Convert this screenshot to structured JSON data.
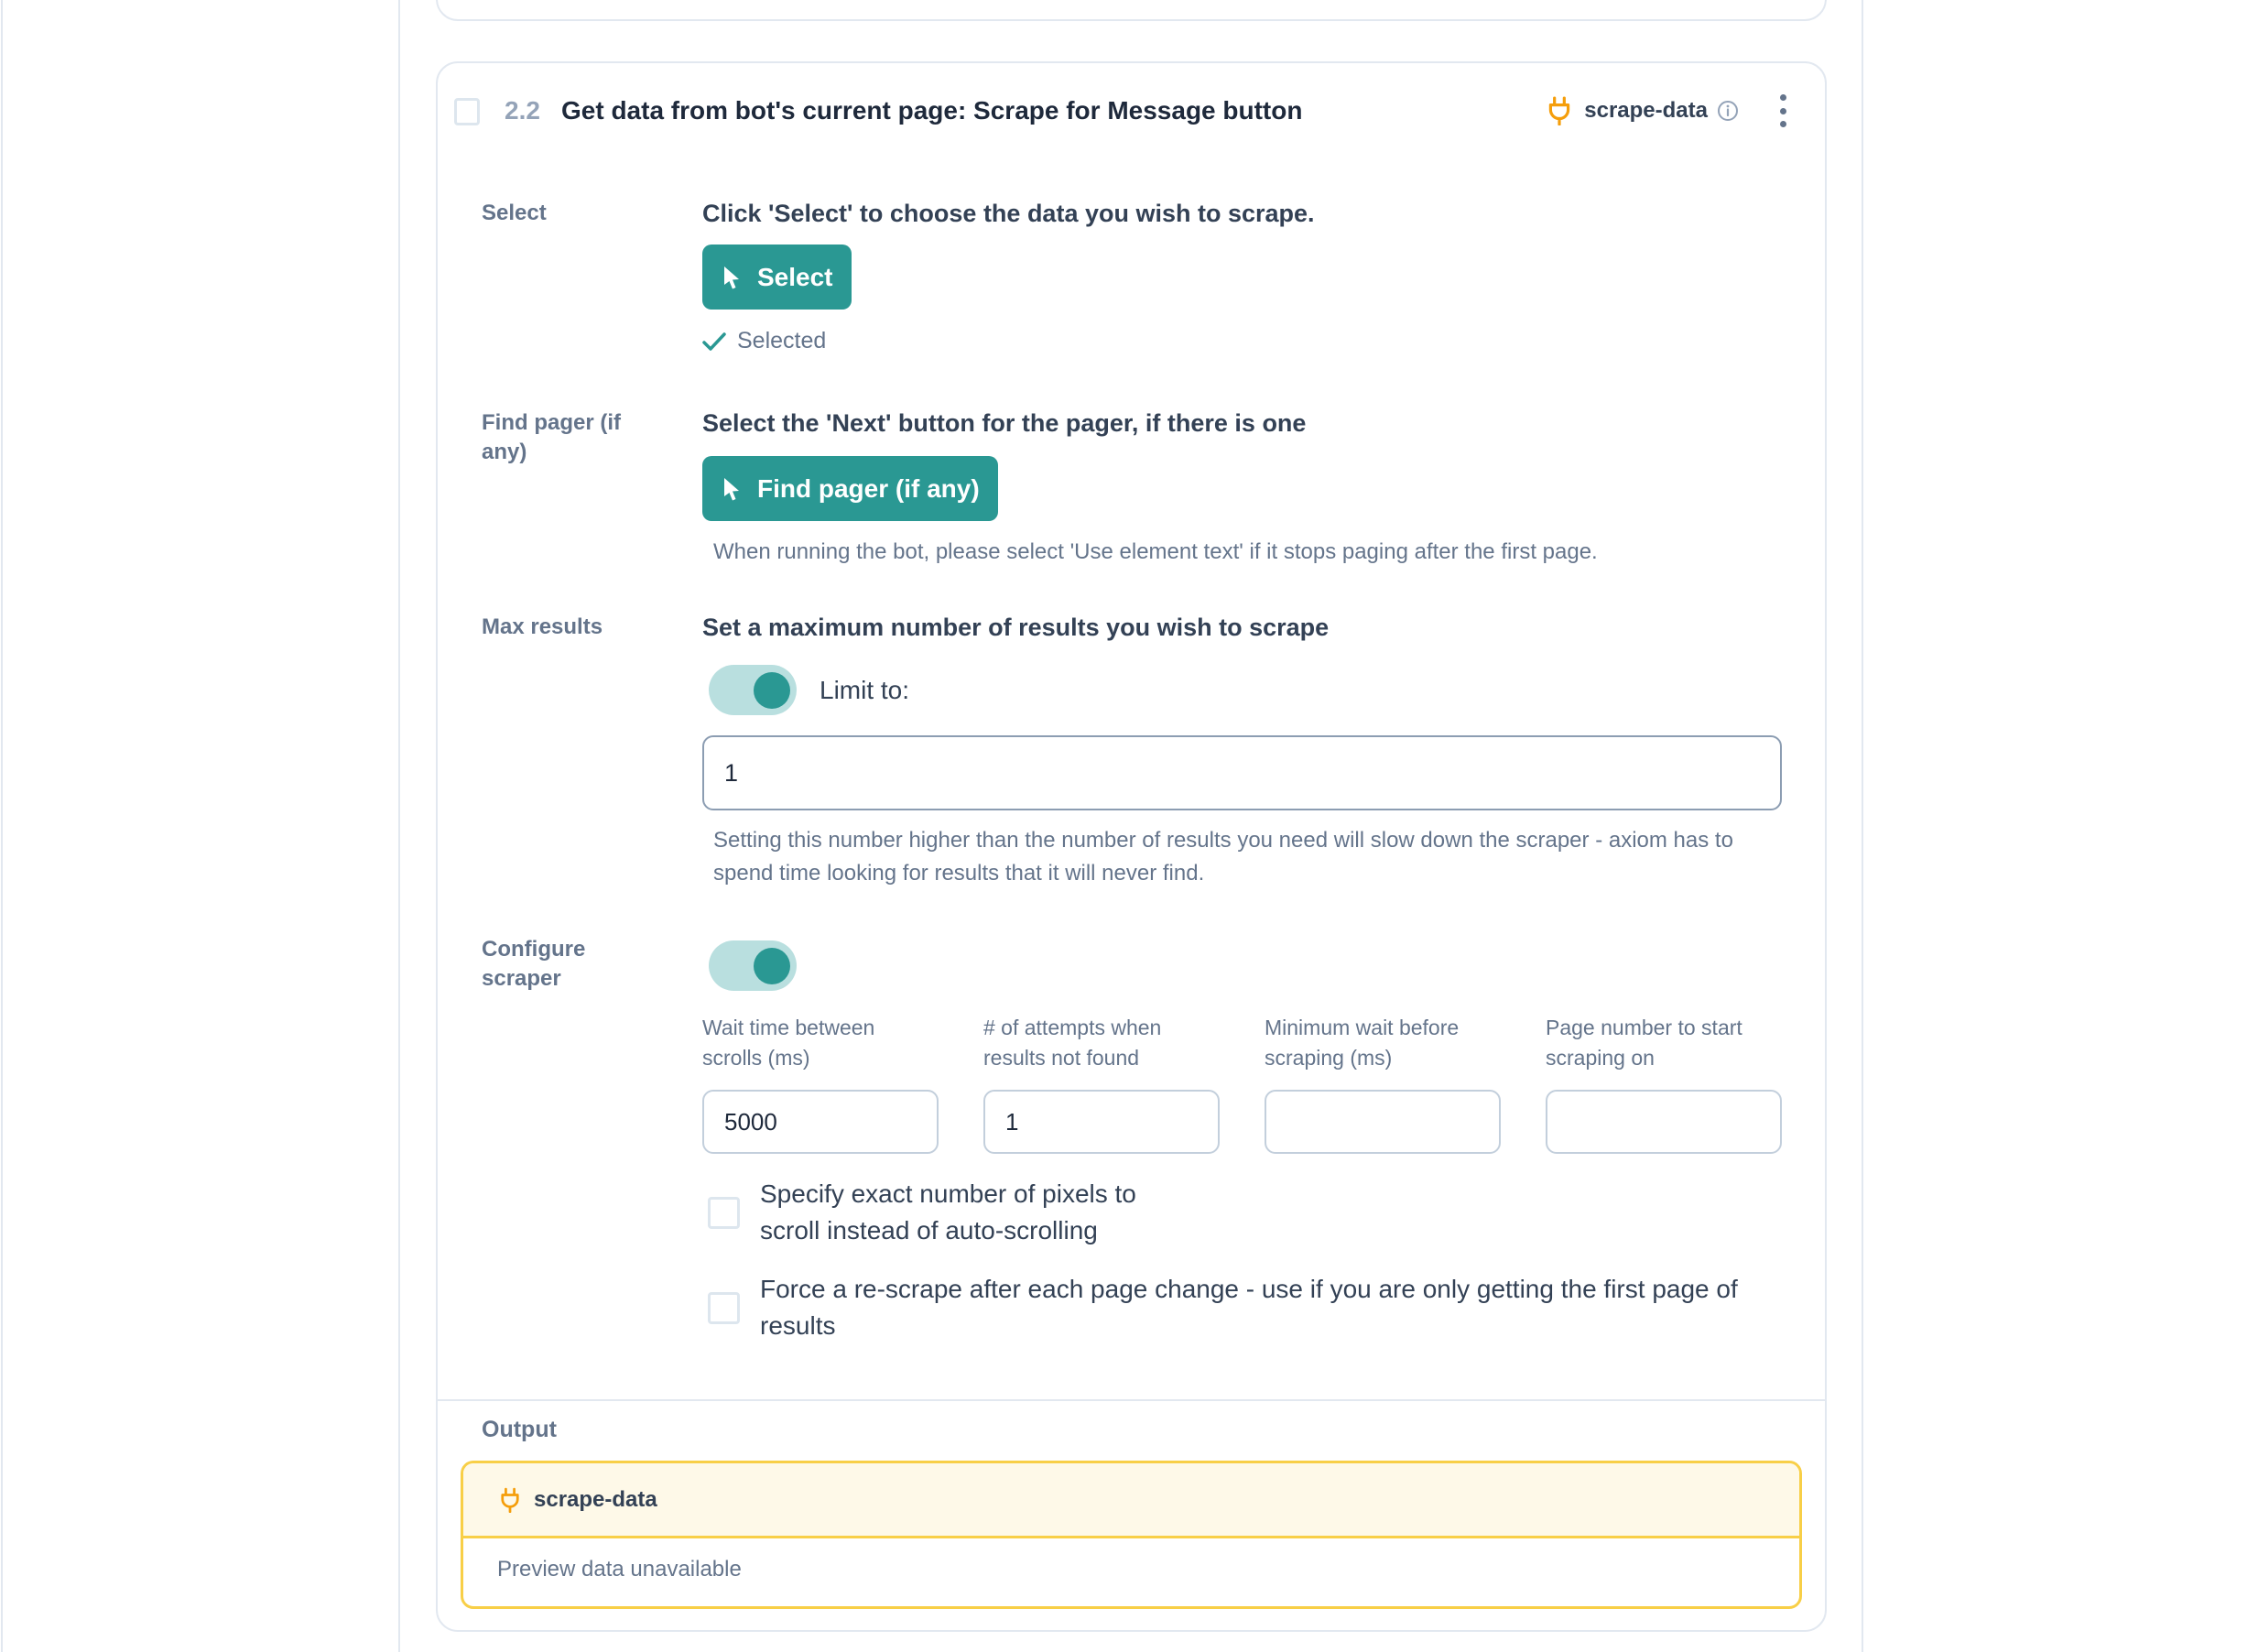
{
  "step": {
    "number": "2.2",
    "title": "Get data from bot's current page: Scrape for Message button",
    "tag": "scrape-data"
  },
  "select": {
    "label": "Select",
    "heading": "Click 'Select' to choose the data you wish to scrape.",
    "button": "Select",
    "status": "Selected"
  },
  "pager": {
    "label": "Find pager (if any)",
    "heading": "Select the 'Next' button for the pager, if there is one",
    "button": "Find pager (if any)",
    "help": "When running the bot, please select 'Use element text' if it stops paging after the first page."
  },
  "max_results": {
    "label": "Max results",
    "heading": "Set a maximum number of results you wish to scrape",
    "toggle_on": true,
    "toggle_label": "Limit to:",
    "value": "1",
    "help": "Setting this number higher than the number of results you need will slow down the scraper - axiom has to spend time looking for results that it will never find."
  },
  "configure": {
    "label": "Configure scraper",
    "toggle_on": true,
    "fields": [
      {
        "label": "Wait time between scrolls (ms)",
        "value": "5000"
      },
      {
        "label": "# of attempts when results not found",
        "value": "1"
      },
      {
        "label": "Minimum wait before scraping (ms)",
        "value": ""
      },
      {
        "label": "Page number to start scraping on",
        "value": ""
      }
    ],
    "checkboxes": [
      {
        "label": "Specify exact number of pixels to scroll instead of auto-scrolling",
        "checked": false
      },
      {
        "label": "Force a re-scrape after each page change - use if you are only getting the first page of results",
        "checked": false
      }
    ]
  },
  "output": {
    "label": "Output",
    "tag": "scrape-data",
    "preview": "Preview data unavailable"
  },
  "colors": {
    "accent": "#2a9893",
    "accent_light": "#b9dfdf",
    "plug": "#f59e0b",
    "output_border": "#f8cf47",
    "output_bg": "#fef9e8"
  }
}
